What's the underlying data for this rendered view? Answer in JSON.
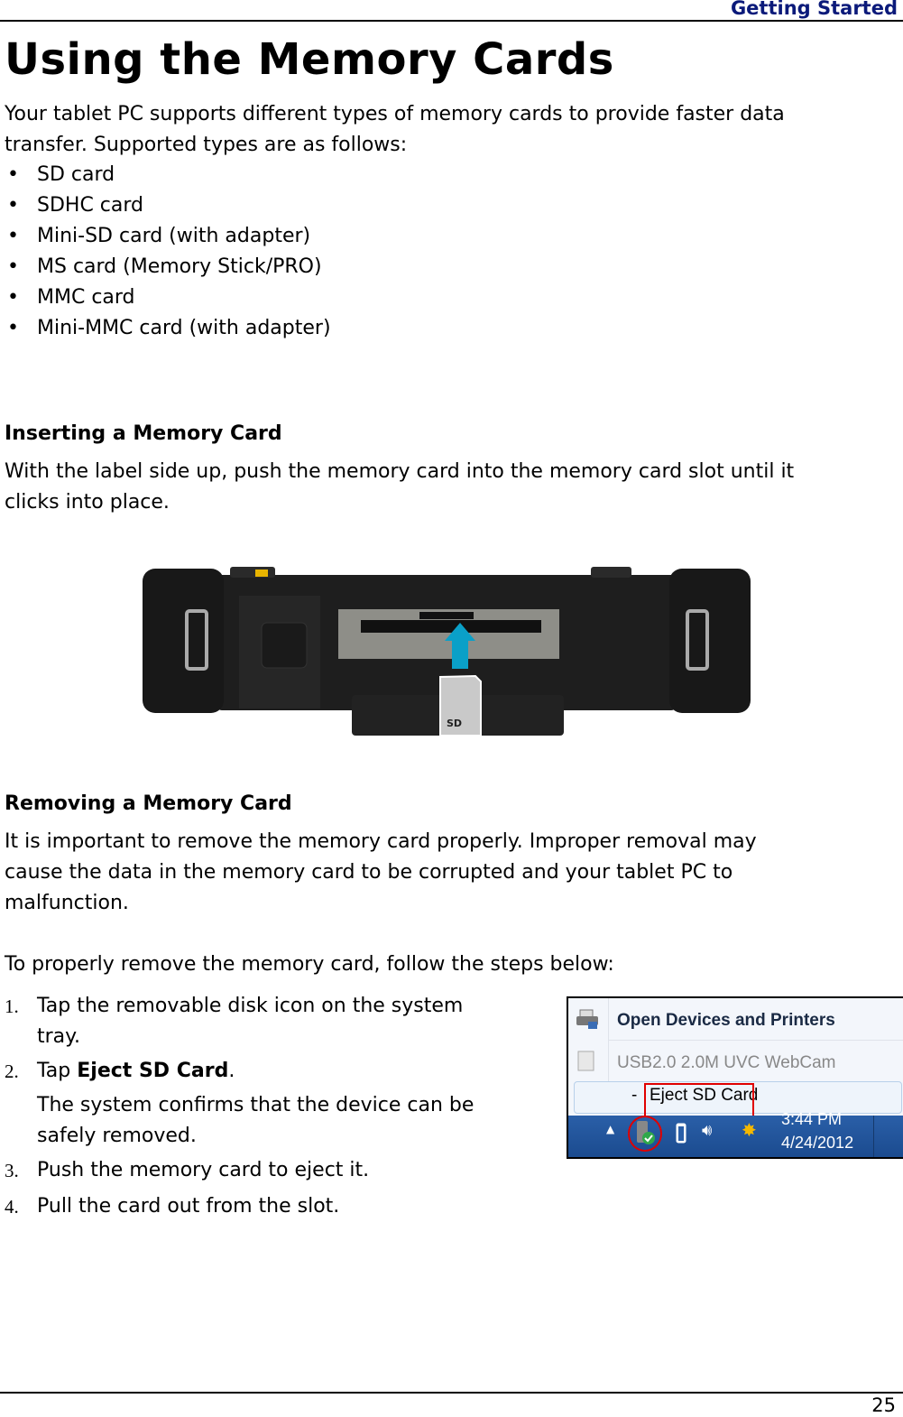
{
  "header": {
    "section_title": "Getting Started"
  },
  "page_title": "Using the Memory Cards",
  "intro": {
    "text_line1": "Your tablet PC supports different types of memory cards to provide faster data",
    "text_line2": "transfer. Supported types are as follows:"
  },
  "card_types": [
    "SD card",
    "SDHC card",
    "Mini-SD card (with adapter)",
    "MS card (Memory Stick/PRO)",
    "MMC card",
    "Mini-MMC card (with adapter)"
  ],
  "inserting": {
    "heading": "Inserting a Memory Card",
    "text_line1": "With the label side up, push the memory card into the memory card slot until it",
    "text_line2": "clicks into place.",
    "figure": {
      "card_label": "SD",
      "arrow_color": "#0aa0c8"
    }
  },
  "removing": {
    "heading": "Removing a Memory Card",
    "text_line1": "It is important to remove the memory card properly. Improper removal may",
    "text_line2": "cause the data in the memory card to be corrupted and your tablet PC to",
    "text_line3": "malfunction.",
    "steps_intro": "To properly remove the memory card, follow the steps below:",
    "steps": [
      {
        "num": "1.",
        "line1": "Tap the removable disk icon on the system",
        "line2": "tray."
      },
      {
        "num": "2.",
        "prefix": "Tap ",
        "bold": "Eject SD Card",
        "suffix": ".",
        "note_line1": "The system confirms that the device can be",
        "note_line2": "safely removed."
      },
      {
        "num": "3.",
        "line1": "Push the memory card to eject it."
      },
      {
        "num": "4.",
        "line1": "Pull the card out from the slot."
      }
    ]
  },
  "screenshot": {
    "menu_items": [
      "Open Devices and Printers",
      "USB2.0 2.0M UVC WebCam",
      "-",
      "Eject SD Card"
    ],
    "tray_time": "3:44 PM",
    "tray_date": "4/24/2012",
    "highlight_color": "#e00000"
  },
  "footer": {
    "page_number": "25"
  }
}
